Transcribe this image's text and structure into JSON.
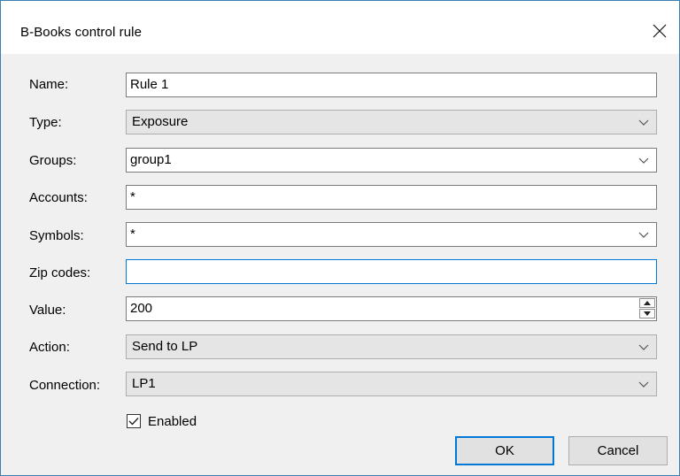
{
  "window": {
    "title": "B-Books control rule",
    "close_icon": "close-icon"
  },
  "form": {
    "name": {
      "label": "Name:",
      "value": "Rule 1"
    },
    "type": {
      "label": "Type:",
      "value": "Exposure"
    },
    "groups": {
      "label": "Groups:",
      "value": "group1"
    },
    "accounts": {
      "label": "Accounts:",
      "value": "*"
    },
    "symbols": {
      "label": "Symbols:",
      "value": "*"
    },
    "zip_codes": {
      "label": "Zip codes:",
      "value": ""
    },
    "value": {
      "label": "Value:",
      "value": "200"
    },
    "action": {
      "label": "Action:",
      "value": "Send to LP"
    },
    "connection": {
      "label": "Connection:",
      "value": "LP1"
    },
    "enabled": {
      "label": "Enabled",
      "checked": true
    }
  },
  "buttons": {
    "ok": "OK",
    "cancel": "Cancel"
  },
  "colors": {
    "accent": "#0078d7",
    "window_border": "#3c7fb1",
    "client_bg": "#f0f0f0"
  }
}
